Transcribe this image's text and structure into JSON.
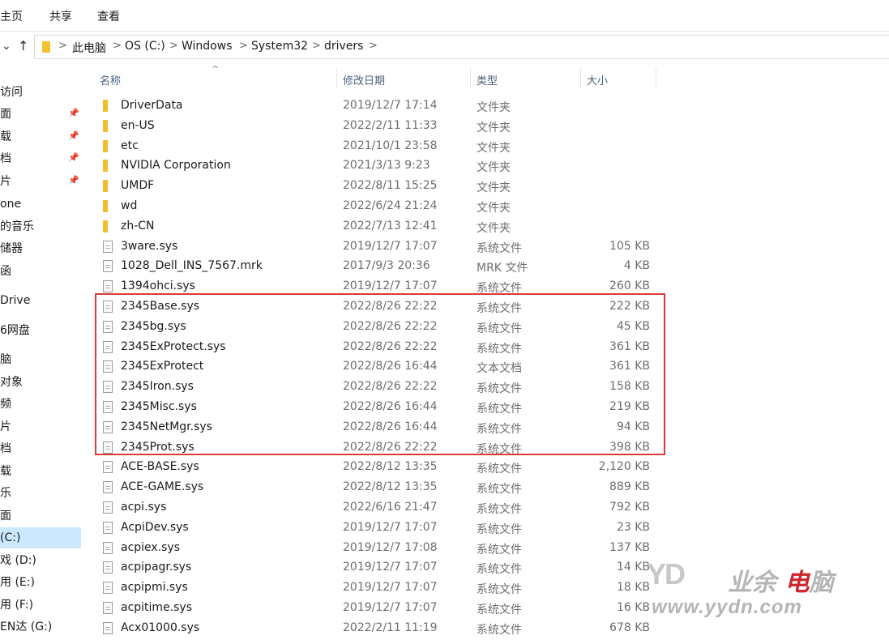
{
  "ribbon": {
    "tabs": [
      "主页",
      "共享",
      "查看"
    ]
  },
  "nav": {
    "back_arrow": "⌄",
    "up_arrow": "↑"
  },
  "breadcrumb": [
    "此电脑",
    "OS (C:)",
    "Windows",
    "System32",
    "drivers"
  ],
  "breadcrumb_separator": ">",
  "sidebar": {
    "items": [
      {
        "label": "访问",
        "pinned": false
      },
      {
        "label": "面",
        "pinned": true
      },
      {
        "label": "载",
        "pinned": true
      },
      {
        "label": "档",
        "pinned": true
      },
      {
        "label": "片",
        "pinned": true
      },
      {
        "label": "one",
        "pinned": false
      },
      {
        "label": "的音乐",
        "pinned": false
      },
      {
        "label": "储器",
        "pinned": false
      },
      {
        "label": "函",
        "pinned": false
      },
      {
        "label": "Drive",
        "pinned": false
      },
      {
        "label": "6网盘",
        "pinned": false
      },
      {
        "label": "脑",
        "pinned": false
      },
      {
        "label": "对象",
        "pinned": false
      },
      {
        "label": "频",
        "pinned": false
      },
      {
        "label": "片",
        "pinned": false
      },
      {
        "label": "档",
        "pinned": false
      },
      {
        "label": "载",
        "pinned": false
      },
      {
        "label": "乐",
        "pinned": false
      },
      {
        "label": "面",
        "pinned": false
      },
      {
        "label": "(C:)",
        "pinned": false,
        "selected": true
      },
      {
        "label": "戏 (D:)",
        "pinned": false
      },
      {
        "label": "用 (E:)",
        "pinned": false
      },
      {
        "label": "用 (F:)",
        "pinned": false
      },
      {
        "label": "EN达 (G:)",
        "pinned": false
      }
    ]
  },
  "columns": {
    "name": "名称",
    "date": "修改日期",
    "type": "类型",
    "size": "大小",
    "sort_indicator": "^"
  },
  "files": [
    {
      "name": "DriverData",
      "date": "2019/12/7 17:14",
      "type": "文件夹",
      "size": "",
      "icon": "folder-icon"
    },
    {
      "name": "en-US",
      "date": "2022/2/11 11:33",
      "type": "文件夹",
      "size": "",
      "icon": "folder-icon"
    },
    {
      "name": "etc",
      "date": "2021/10/1 23:58",
      "type": "文件夹",
      "size": "",
      "icon": "folder-icon"
    },
    {
      "name": "NVIDIA Corporation",
      "date": "2021/3/13 9:23",
      "type": "文件夹",
      "size": "",
      "icon": "folder-icon"
    },
    {
      "name": "UMDF",
      "date": "2022/8/11 15:25",
      "type": "文件夹",
      "size": "",
      "icon": "folder-icon"
    },
    {
      "name": "wd",
      "date": "2022/6/24 21:24",
      "type": "文件夹",
      "size": "",
      "icon": "folder-icon"
    },
    {
      "name": "zh-CN",
      "date": "2022/7/13 12:41",
      "type": "文件夹",
      "size": "",
      "icon": "folder-icon"
    },
    {
      "name": "3ware.sys",
      "date": "2019/12/7 17:07",
      "type": "系统文件",
      "size": "105 KB",
      "icon": "system-file-icon"
    },
    {
      "name": "1028_Dell_INS_7567.mrk",
      "date": "2017/9/3 20:36",
      "type": "MRK 文件",
      "size": "4 KB",
      "icon": "file-icon"
    },
    {
      "name": "1394ohci.sys",
      "date": "2019/12/7 17:07",
      "type": "系统文件",
      "size": "260 KB",
      "icon": "system-file-icon"
    },
    {
      "name": "2345Base.sys",
      "date": "2022/8/26 22:22",
      "type": "系统文件",
      "size": "222 KB",
      "icon": "system-file-icon"
    },
    {
      "name": "2345bg.sys",
      "date": "2022/8/26 22:22",
      "type": "系统文件",
      "size": "45 KB",
      "icon": "system-file-icon"
    },
    {
      "name": "2345ExProtect.sys",
      "date": "2022/8/26 22:22",
      "type": "系统文件",
      "size": "361 KB",
      "icon": "system-file-icon"
    },
    {
      "name": "2345ExProtect",
      "date": "2022/8/26 16:44",
      "type": "文本文档",
      "size": "361 KB",
      "icon": "text-file-icon"
    },
    {
      "name": "2345Iron.sys",
      "date": "2022/8/26 22:22",
      "type": "系统文件",
      "size": "158 KB",
      "icon": "system-file-icon"
    },
    {
      "name": "2345Misc.sys",
      "date": "2022/8/26 16:44",
      "type": "系统文件",
      "size": "219 KB",
      "icon": "system-file-icon"
    },
    {
      "name": "2345NetMgr.sys",
      "date": "2022/8/26 16:44",
      "type": "系统文件",
      "size": "94 KB",
      "icon": "system-file-icon"
    },
    {
      "name": "2345Prot.sys",
      "date": "2022/8/26 22:22",
      "type": "系统文件",
      "size": "398 KB",
      "icon": "system-file-icon"
    },
    {
      "name": "ACE-BASE.sys",
      "date": "2022/8/12 13:35",
      "type": "系统文件",
      "size": "2,120 KB",
      "icon": "system-file-icon"
    },
    {
      "name": "ACE-GAME.sys",
      "date": "2022/8/12 13:35",
      "type": "系统文件",
      "size": "889 KB",
      "icon": "system-file-icon"
    },
    {
      "name": "acpi.sys",
      "date": "2022/6/16 21:47",
      "type": "系统文件",
      "size": "792 KB",
      "icon": "system-file-icon"
    },
    {
      "name": "AcpiDev.sys",
      "date": "2019/12/7 17:07",
      "type": "系统文件",
      "size": "23 KB",
      "icon": "system-file-icon"
    },
    {
      "name": "acpiex.sys",
      "date": "2019/12/7 17:08",
      "type": "系统文件",
      "size": "137 KB",
      "icon": "system-file-icon"
    },
    {
      "name": "acpipagr.sys",
      "date": "2019/12/7 17:07",
      "type": "系统文件",
      "size": "14 KB",
      "icon": "system-file-icon"
    },
    {
      "name": "acpipmi.sys",
      "date": "2019/12/7 17:07",
      "type": "系统文件",
      "size": "18 KB",
      "icon": "system-file-icon"
    },
    {
      "name": "acpitime.sys",
      "date": "2019/12/7 17:07",
      "type": "系统文件",
      "size": "16 KB",
      "icon": "system-file-icon"
    },
    {
      "name": "Acx01000.sys",
      "date": "2022/2/11 11:19",
      "type": "系统文件",
      "size": "678 KB",
      "icon": "system-file-icon"
    }
  ],
  "highlight_color": "#d93a3a",
  "watermark": {
    "logo_mark": "YD",
    "chars_gray": "业余",
    "chars_red": "电",
    "chars_gray2": "脑",
    "url": "www.yydn.com"
  }
}
